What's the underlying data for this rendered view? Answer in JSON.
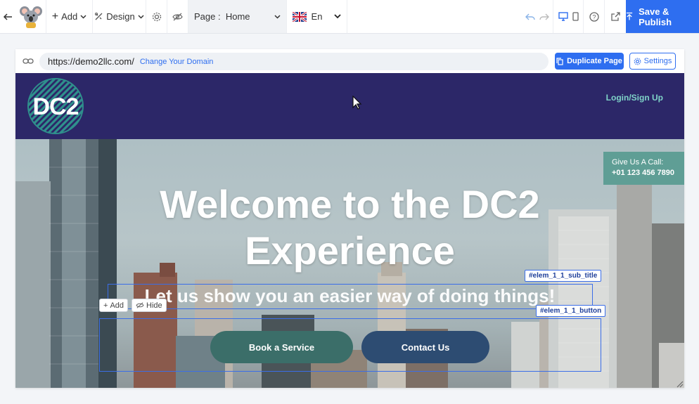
{
  "toolbar": {
    "add_label": "Add",
    "design_label": "Design",
    "page_prefix": "Page :",
    "page_value": "Home",
    "language": "En",
    "publish_label": "Save & Publish"
  },
  "frame": {
    "url": "https://demo2llc.com/",
    "change_domain": "Change Your Domain",
    "duplicate_label": "Duplicate Page",
    "settings_label": "Settings"
  },
  "site": {
    "logo_text": "DC2",
    "login_label": "Login/Sign Up",
    "call_label": "Give Us A Call:",
    "call_number": "+01 123 456 7890",
    "hero_title_line1": "Welcome to the DC2",
    "hero_title_line2": "Experience",
    "hero_subtitle": "Let us show you an easier way of doing things!",
    "book_label": "Book a Service",
    "contact_label": "Contact Us"
  },
  "editor": {
    "subtitle_tag": "#elem_1_1_sub_title",
    "button_tag": "#elem_1_1_button",
    "add_label": "Add",
    "hide_label": "Hide"
  },
  "colors": {
    "accent": "#2e6ef0",
    "header_bg": "#2c2768",
    "teal": "#5f9e95",
    "book_btn": "#3b6e69",
    "contact_btn": "#2d4c72"
  }
}
